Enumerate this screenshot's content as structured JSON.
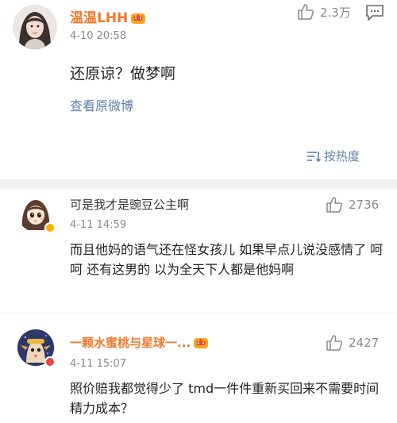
{
  "main_post": {
    "username": "温温LHH",
    "time": "4-10 20:58",
    "like_count": "2.3万",
    "text": "还原谅？做梦啊",
    "view_original": "查看原微博",
    "sort_label": "按热度"
  },
  "comments": [
    {
      "username": "可是我才是豌豆公主啊",
      "time": "4-11 14:59",
      "like_count": "2736",
      "text": "而且他妈的语气还在怪女孩儿 如果早点儿说没感情了 呵呵  还有这男的 以为全天下人都是他妈啊"
    },
    {
      "username": "一颗水蜜桃与星球一...",
      "time": "4-11 15:07",
      "like_count": "2427",
      "text": "照价赔我都觉得少了 tmd一件件重新买回来不需要时间精力成本？"
    }
  ],
  "colors": {
    "vip_orange": "#ef7a2c",
    "link_blue": "#5b7faa",
    "meta_gray": "#8a8a8a"
  }
}
